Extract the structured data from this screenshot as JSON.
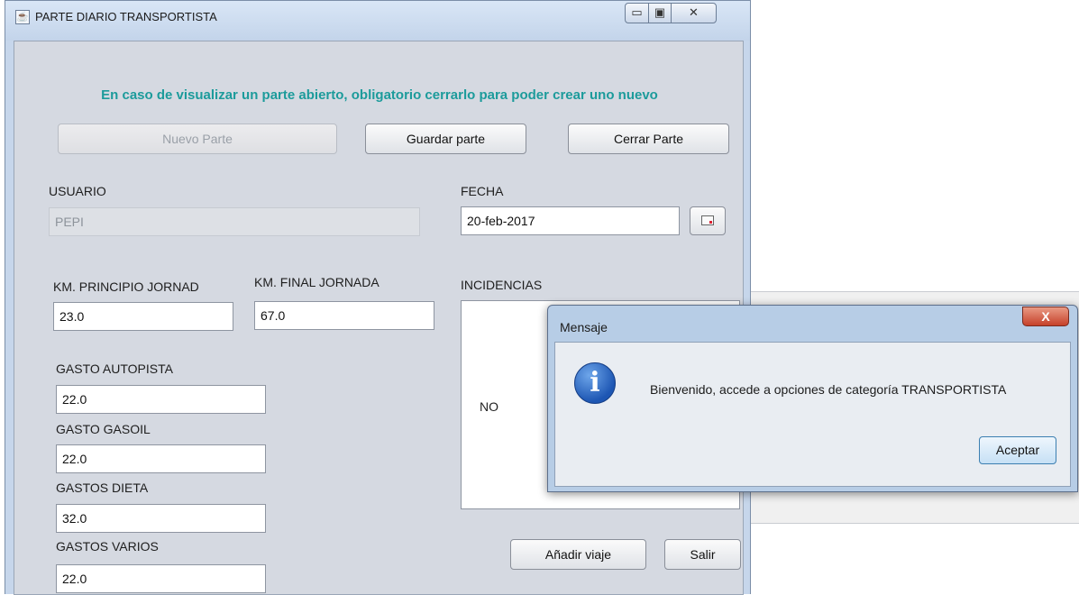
{
  "main_window": {
    "title": "PARTE DIARIO TRANSPORTISTA",
    "controls": {
      "minimize": "▭",
      "maximize": "▣",
      "close": "✕"
    },
    "notice": "En caso de visualizar un parte abierto, obligatorio cerrarlo para poder crear uno nuevo",
    "buttons": {
      "nuevo_parte": "Nuevo Parte",
      "guardar_parte": "Guardar parte",
      "cerrar_parte": "Cerrar Parte",
      "anadir_viaje": "Añadir viaje",
      "salir": "Salir"
    },
    "labels": {
      "usuario": "USUARIO",
      "fecha": "FECHA",
      "km_principio": "KM. PRINCIPIO JORNAD",
      "km_final": "KM. FINAL JORNADA",
      "incidencias": "INCIDENCIAS",
      "gasto_autopista": "GASTO AUTOPISTA",
      "gasto_gasoil": "GASTO GASOIL",
      "gastos_dieta": "GASTOS DIETA",
      "gastos_varios": "GASTOS VARIOS"
    },
    "values": {
      "usuario": "PEPI",
      "fecha": "20-feb-2017",
      "km_principio": "23.0",
      "km_final": "67.0",
      "incidencias": "NO",
      "gasto_autopista": "22.0",
      "gasto_gasoil": "22.0",
      "gastos_dieta": "32.0",
      "gastos_varios": "22.0"
    }
  },
  "dialog": {
    "title": "Mensaje",
    "close": "X",
    "icon": "i",
    "message": "Bienvenido, accede a opciones de categoría TRANSPORTISTA",
    "accept": "Aceptar"
  },
  "icons": {
    "app": "java-cup-icon",
    "calendar": "calendar-icon",
    "info": "info-icon"
  },
  "colors": {
    "notice": "#1c9b9b",
    "titlebar": "#c6d6eb",
    "panel": "#d5d9e1",
    "dialog_close": "#c6412a"
  }
}
